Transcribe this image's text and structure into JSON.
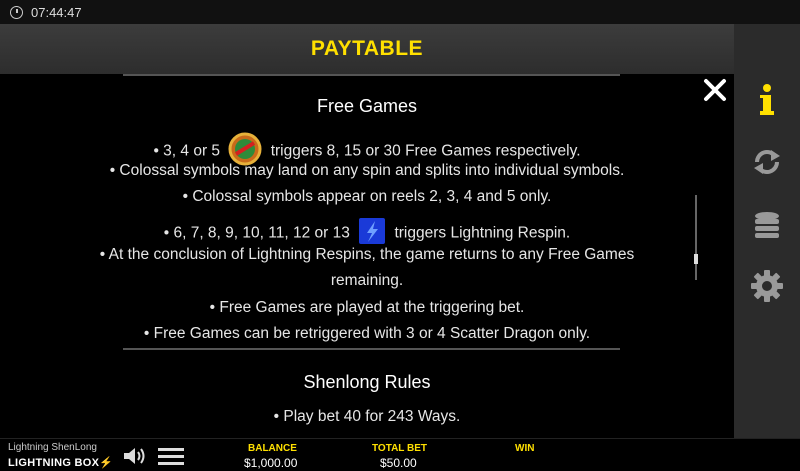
{
  "status": {
    "time": "07:44:47"
  },
  "header": {
    "title": "PAYTABLE"
  },
  "free_games": {
    "heading": "Free Games",
    "line1_pre": "• 3, 4 or 5",
    "line1_post": "triggers 8, 15 or 30 Free Games respectively.",
    "line2": "• Colossal symbols may land on any spin and splits into individual symbols.",
    "line3": "• Colossal symbols appear on reels 2, 3, 4 and 5 only.",
    "line4_pre": "• 6, 7, 8, 9, 10, 11, 12 or 13",
    "line4_post": "triggers Lightning Respin.",
    "line5": "• At the conclusion of Lightning Respins, the game returns to any Free Games",
    "line6": "remaining.",
    "line7": "• Free Games are played at the triggering bet.",
    "line8": "• Free Games can be retriggered with 3 or 4 Scatter Dragon only."
  },
  "shenlong": {
    "heading": "Shenlong Rules",
    "line1": "• Play bet 40 for 243 Ways."
  },
  "sidebar": {
    "icons": [
      "info-icon",
      "autoplay-icon",
      "coins-icon",
      "settings-icon"
    ],
    "active_color": "#ffe000"
  },
  "footer": {
    "game_name": "Lightning ShenLong",
    "brand": "LIGHTNING BOX",
    "balance_label": "BALANCE",
    "balance_value": "$1,000.00",
    "total_bet_label": "TOTAL BET",
    "total_bet_value": "$50.00",
    "win_label": "WIN"
  }
}
